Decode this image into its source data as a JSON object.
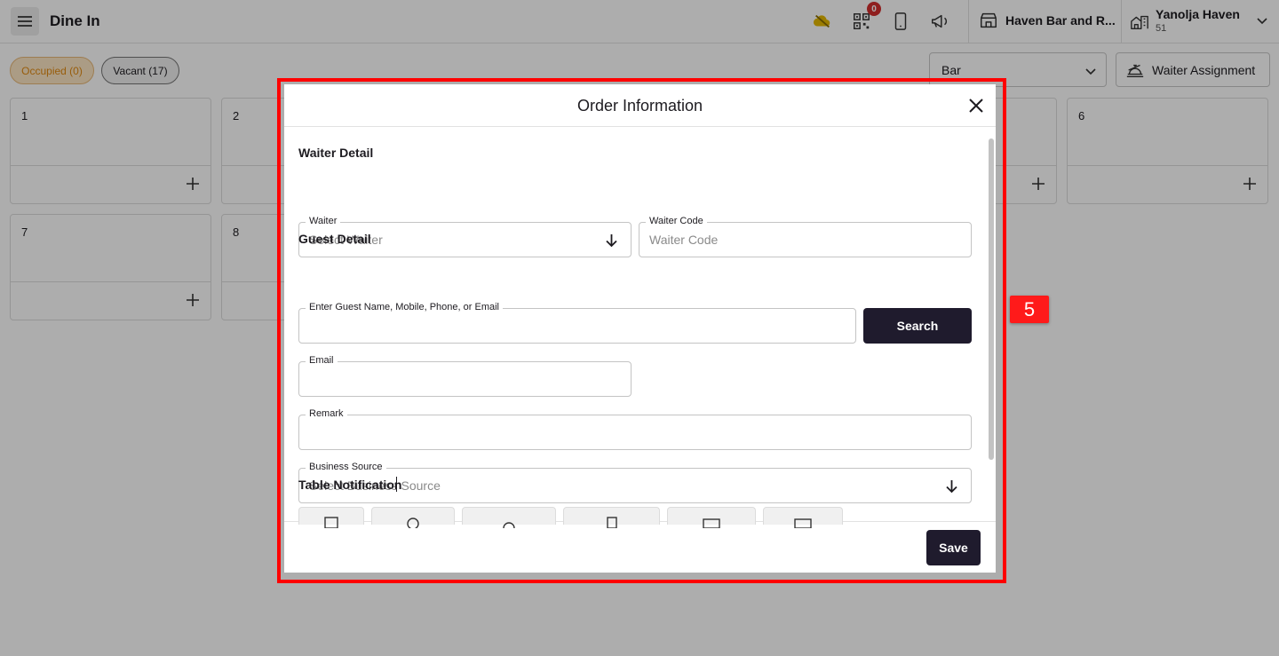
{
  "app": {
    "page_title": "Dine In",
    "notification_count": "0",
    "property_name": "Haven Bar and R...",
    "user": {
      "name": "Yanolja Haven",
      "sub": "51"
    }
  },
  "filters": {
    "occupied": "Occupied (0)",
    "vacant": "Vacant (17)",
    "outlet_select": "Bar",
    "waiter_assignment": "Waiter Assignment"
  },
  "tables": [
    {
      "number": "1"
    },
    {
      "number": "2"
    },
    {
      "number": "6"
    },
    {
      "number": "7"
    },
    {
      "number": "8"
    }
  ],
  "modal": {
    "title": "Order Information",
    "waiter_section": "Waiter Detail",
    "waiter_label": "Waiter",
    "waiter_placeholder": "Select Waiter",
    "waiter_code_label": "Waiter Code",
    "waiter_code_placeholder": "Waiter Code",
    "guest_section": "Guest Detail",
    "guest_search_label": "Enter Guest Name, Mobile, Phone, or Email",
    "search_button": "Search",
    "email_label": "Email",
    "remark_label": "Remark",
    "business_source_label": "Business Source",
    "business_source_placeholder": "Select Business Source",
    "notification_section": "Table Notification",
    "save_button": "Save"
  },
  "annotation": {
    "step": "5"
  },
  "colors": {
    "accent": "#1f1b2d",
    "highlight": "#ff0000",
    "occupied": "#e08a12",
    "badge": "#d32f2f"
  }
}
